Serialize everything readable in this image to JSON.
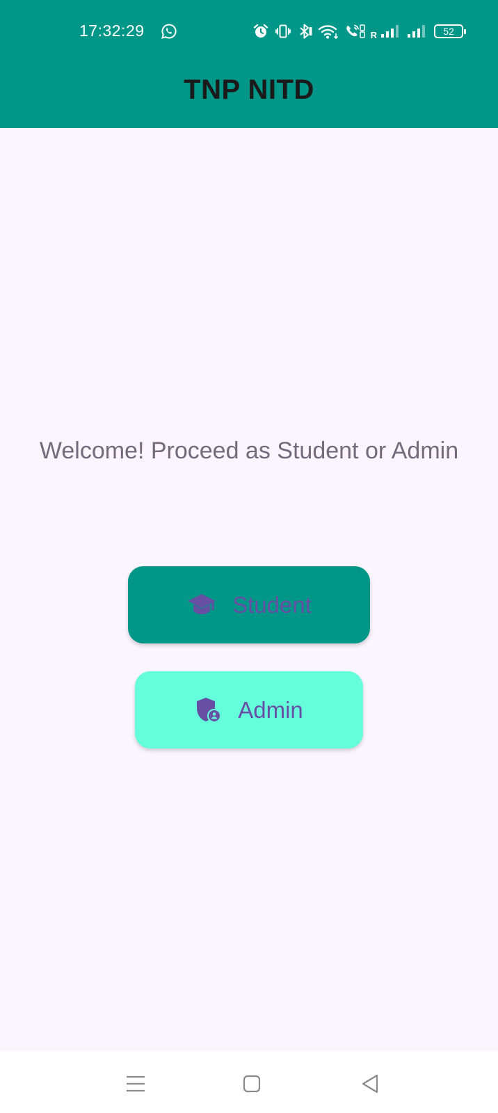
{
  "status_bar": {
    "time": "17:32:29",
    "left_icon": "whatsapp-icon",
    "icons": [
      "alarm-icon",
      "vibrate-icon",
      "bluetooth-icon",
      "wifi-icon",
      "call-icon",
      "signal-icon",
      "signal-icon"
    ],
    "sim_roaming_label": "R",
    "battery_level": "52"
  },
  "app_bar": {
    "title": "TNP NITD",
    "color": "#009688"
  },
  "main": {
    "welcome_text": "Welcome! Proceed as Student or Admin",
    "buttons": [
      {
        "label": "Student",
        "icon": "graduation-cap-icon",
        "background": "#009688"
      },
      {
        "label": "Admin",
        "icon": "admin-shield-icon",
        "background": "#64FFDA"
      }
    ],
    "button_text_color": "#6750A4"
  },
  "nav_bar": {
    "items": [
      "menu-icon",
      "home-icon",
      "back-icon"
    ]
  }
}
